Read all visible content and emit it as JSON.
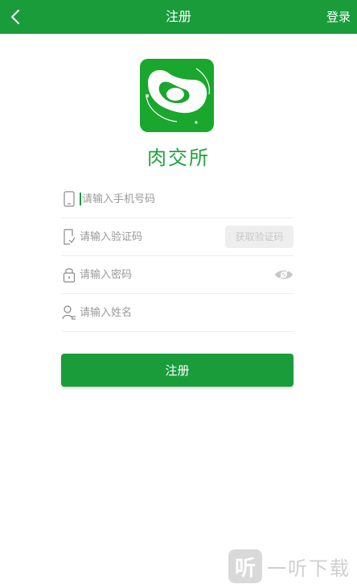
{
  "header": {
    "title": "注册",
    "login_label": "登录"
  },
  "brand": {
    "name": "肉交所"
  },
  "form": {
    "phone_placeholder": "请输入手机号码",
    "code_placeholder": "请输入验证码",
    "get_code_label": "获取验证码",
    "password_placeholder": "请输入密码",
    "name_placeholder": "请输入姓名"
  },
  "submit_label": "注册",
  "watermark": {
    "logo_char": "听",
    "text": "一听下载"
  },
  "colors": {
    "primary": "#1a9c3b",
    "logo_bg": "#19a72d",
    "placeholder": "#9a9a9a"
  }
}
